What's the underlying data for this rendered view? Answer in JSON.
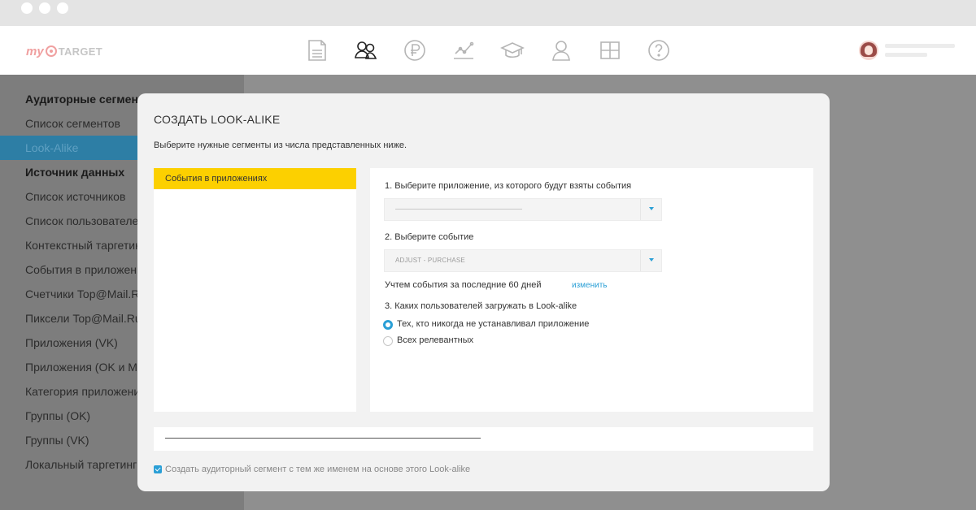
{
  "header": {
    "logo_my": "my",
    "logo_target": "TARGET",
    "nav_icons": [
      "document-icon",
      "audience-icon",
      "ruble-icon",
      "stats-icon",
      "education-icon",
      "profile-icon",
      "tools-icon",
      "help-icon"
    ]
  },
  "sidebar": {
    "items": [
      {
        "label": "Аудиторные сегменты"
      },
      {
        "label": "Список сегментов"
      },
      {
        "label": "Look-Alike"
      },
      {
        "label": "Источник данных"
      },
      {
        "label": "Список источников"
      },
      {
        "label": "Список пользователей"
      },
      {
        "label": "Контекстный таргетинг"
      },
      {
        "label": "События в приложениях"
      },
      {
        "label": "Счетчики Top@Mail.Ru"
      },
      {
        "label": "Пиксели Top@Mail.Ru"
      },
      {
        "label": "Приложения (VK)"
      },
      {
        "label": "Приложения (OK и Мой Мир)"
      },
      {
        "label": "Категория приложений"
      },
      {
        "label": "Группы (OK)"
      },
      {
        "label": "Группы (VK)"
      },
      {
        "label": "Локальный таргетинг"
      }
    ]
  },
  "modal": {
    "title": "СОЗДАТЬ LOOK-ALIKE",
    "subtitle": "Выберите нужные сегменты из числа представленных ниже.",
    "source_item": "События в приложениях",
    "step1_label": "1. Выберите приложение, из которого будут взяты события",
    "step2_label": "2. Выберите событие",
    "event_value": "ADJUST - PURCHASE",
    "period_text": "Учтем события за последние 60 дней",
    "change_link": "изменить",
    "step3_label": "3. Каких пользователей загружать в Look-alike",
    "radio_options": [
      {
        "label": "Тех, кто никогда не устанавливал приложение",
        "selected": true
      },
      {
        "label": "Всех релевантных",
        "selected": false
      }
    ],
    "checkbox_label": "Создать аудиторный сегмент с тем же именем на основе этого Look-alike",
    "checkbox_checked": true
  },
  "colors": {
    "accent": "#2a9fd6",
    "highlight": "#fcd000",
    "sidebar_active": "#2d7ea5"
  }
}
